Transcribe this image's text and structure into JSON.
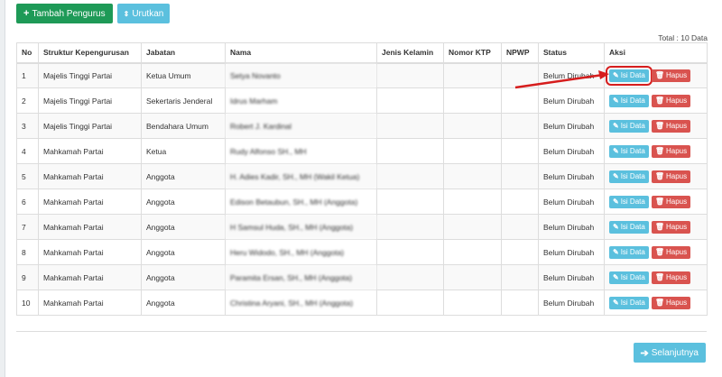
{
  "toolbar": {
    "add_label": "Tambah Pengurus",
    "sort_label": "Urutkan"
  },
  "total_label": "Total : 10 Data",
  "table": {
    "headers": [
      "No",
      "Struktur Kepengurusan",
      "Jabatan",
      "Nama",
      "Jenis Kelamin",
      "Nomor KTP",
      "NPWP",
      "Status",
      "Aksi"
    ],
    "rows": [
      {
        "no": "1",
        "struktur": "Majelis Tinggi Partai",
        "jabatan": "Ketua Umum",
        "nama": "Setya Novanto",
        "jk": "",
        "ktp": "",
        "npwp": "",
        "status": "Belum Dirubah"
      },
      {
        "no": "2",
        "struktur": "Majelis Tinggi Partai",
        "jabatan": "Sekertaris Jenderal",
        "nama": "Idrus Marham",
        "jk": "",
        "ktp": "",
        "npwp": "",
        "status": "Belum Dirubah"
      },
      {
        "no": "3",
        "struktur": "Majelis Tinggi Partai",
        "jabatan": "Bendahara Umum",
        "nama": "Robert J. Kardinal",
        "jk": "",
        "ktp": "",
        "npwp": "",
        "status": "Belum Dirubah"
      },
      {
        "no": "4",
        "struktur": "Mahkamah Partai",
        "jabatan": "Ketua",
        "nama": "Rudy Alfonso SH., MH",
        "jk": "",
        "ktp": "",
        "npwp": "",
        "status": "Belum Dirubah"
      },
      {
        "no": "5",
        "struktur": "Mahkamah Partai",
        "jabatan": "Anggota",
        "nama": "H. Adies Kadir, SH., MH (Wakil Ketua)",
        "jk": "",
        "ktp": "",
        "npwp": "",
        "status": "Belum Dirubah"
      },
      {
        "no": "6",
        "struktur": "Mahkamah Partai",
        "jabatan": "Anggota",
        "nama": "Edison Betaubun, SH., MH (Anggota)",
        "jk": "",
        "ktp": "",
        "npwp": "",
        "status": "Belum Dirubah"
      },
      {
        "no": "7",
        "struktur": "Mahkamah Partai",
        "jabatan": "Anggota",
        "nama": "H Samsul Huda, SH., MH (Anggota)",
        "jk": "",
        "ktp": "",
        "npwp": "",
        "status": "Belum Dirubah"
      },
      {
        "no": "8",
        "struktur": "Mahkamah Partai",
        "jabatan": "Anggota",
        "nama": "Heru Widodo, SH., MH (Anggota)",
        "jk": "",
        "ktp": "",
        "npwp": "",
        "status": "Belum Dirubah"
      },
      {
        "no": "9",
        "struktur": "Mahkamah Partai",
        "jabatan": "Anggota",
        "nama": "Paramita Ersan, SH., MH (Anggota)",
        "jk": "",
        "ktp": "",
        "npwp": "",
        "status": "Belum Dirubah"
      },
      {
        "no": "10",
        "struktur": "Mahkamah Partai",
        "jabatan": "Anggota",
        "nama": "Christina Aryani, SH., MH (Anggota)",
        "jk": "",
        "ktp": "",
        "npwp": "",
        "status": "Belum Dirubah"
      }
    ],
    "edit_label": "Isi Data",
    "delete_label": "Hapus"
  },
  "next_label": "Selanjutnya",
  "colors": {
    "green": "#1e9a57",
    "info": "#5bc0de",
    "danger": "#d9534f",
    "annotation": "#d61d1d"
  },
  "icons": {
    "add": "plus-icon",
    "sort": "sort-icon",
    "edit": "pencil-icon",
    "delete": "trash-icon",
    "next": "arrow-right-icon"
  }
}
